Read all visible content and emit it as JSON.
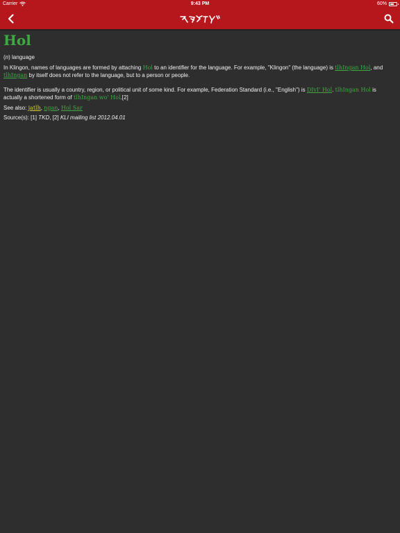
{
  "status": {
    "carrier": "Carrier",
    "time": "9:43 PM",
    "battery_text": "60%",
    "battery_level": 0.6
  },
  "nav": {
    "back_icon": "chevron-left-icon",
    "search_icon": "search-icon",
    "logo": "klingon-script-logo",
    "color": "#b5171d"
  },
  "entry": {
    "title": "Hol",
    "pos": "n",
    "definition": "language",
    "p1": [
      "In Klingon, names of languages are formed by attaching ",
      "Hol",
      " to an identifier for the language. For example, \"Klingon\" (the language) is ",
      "tlhIngan Hol",
      ", and ",
      "tlhIngan",
      " by itself does not refer to the language, but to a person or people."
    ],
    "p2": [
      "The identifier is usually a country, region, or political unit of some kind. For example, Federation Standard (i.e., \"English\") is ",
      "DIvI' Hol",
      ". ",
      "tlhIngan Hol",
      " is actually a shortened form of ",
      "tlhIngan wo' Hol",
      ".[2]"
    ],
    "see_also": {
      "label": "See also: ",
      "items": [
        "jatlh",
        "ngan",
        "Hol Sar"
      ]
    },
    "sources": {
      "label": "Source(s): ",
      "items": [
        "[1] ",
        "TKD",
        ", [2] ",
        "KLI mailing list 2012.04.01"
      ]
    }
  },
  "colors": {
    "background": "#2e2e2e",
    "link_green": "#3fa944",
    "link_yellow": "#d9cf3a",
    "text": "#f2f2f2"
  }
}
